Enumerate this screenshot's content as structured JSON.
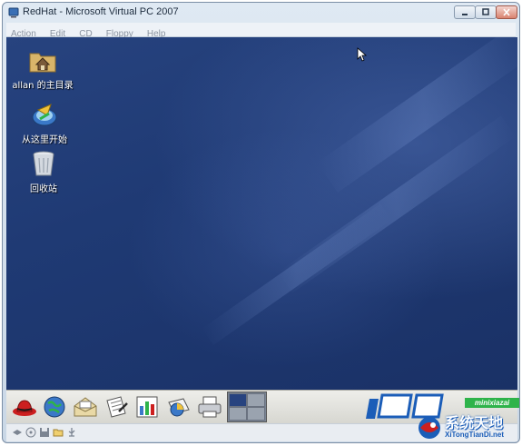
{
  "window": {
    "title": "RedHat - Microsoft Virtual PC 2007",
    "icon": "virtual-pc-icon",
    "controls": [
      "minimize-icon",
      "maximize-icon",
      "close-icon"
    ]
  },
  "menubar": {
    "items": [
      {
        "label": "Action"
      },
      {
        "label": "Edit"
      },
      {
        "label": "CD"
      },
      {
        "label": "Floppy"
      },
      {
        "label": "Help"
      }
    ]
  },
  "desktop": {
    "icons": [
      {
        "label": "allan 的主目录",
        "icon": "home-folder-icon"
      },
      {
        "label": "从这里开始",
        "icon": "start-here-icon"
      },
      {
        "label": "回收站",
        "icon": "trash-icon"
      }
    ]
  },
  "panel": {
    "launchers": [
      "redhat-menu-icon",
      "web-browser-icon",
      "email-icon",
      "text-editor-icon",
      "spreadsheet-icon",
      "presentation-icon",
      "printer-icon"
    ],
    "workspaces": 4,
    "active_workspace": 1
  },
  "statusbar": {
    "icons": [
      "network-icon",
      "cd-icon",
      "floppy-icon",
      "folder-icon",
      "usb-icon"
    ]
  },
  "watermark": {
    "mini_text": "minixiazai",
    "brand_text": "系统天地",
    "site_text": "XiTongTianDi.net"
  },
  "colors": {
    "desktop": "#1f3a74",
    "redhat_red": "#cc1f1f",
    "watermark_blue": "#1b5db8",
    "watermark_green": "#2eb34a"
  }
}
